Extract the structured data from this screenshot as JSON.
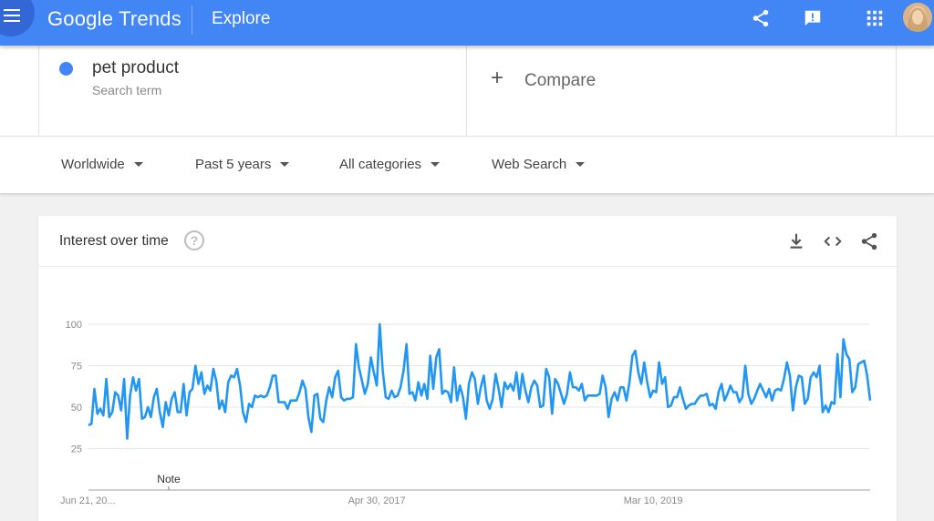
{
  "header": {
    "brand_google": "Google",
    "brand_trends": "Trends",
    "page": "Explore",
    "icons": [
      "menu-icon",
      "share-icon",
      "feedback-icon",
      "apps-icon",
      "avatar"
    ]
  },
  "search": {
    "term": "pet product",
    "term_sub": "Search term",
    "term_color": "#4285f4",
    "compare_label": "Compare"
  },
  "filters": {
    "region": "Worldwide",
    "period": "Past 5 years",
    "category": "All categories",
    "search_type": "Web Search"
  },
  "card": {
    "title": "Interest over time",
    "icons": [
      "help-icon",
      "download-icon",
      "embed-icon",
      "share-icon"
    ]
  },
  "chart_data": {
    "type": "line",
    "series_color": "#2196f3",
    "ylim": [
      0,
      100
    ],
    "y_ticks": [
      25,
      50,
      75,
      100
    ],
    "x_labels": [
      {
        "label": "Jun 21, 20...",
        "index": 0
      },
      {
        "label": "Apr 30, 2017",
        "index": 97
      },
      {
        "label": "Mar 10, 2019",
        "index": 190
      }
    ],
    "note_label": "Note",
    "note_index": 27,
    "series": [
      {
        "values": [
          39,
          40,
          61,
          46,
          49,
          45,
          67,
          44,
          47,
          59,
          57,
          48,
          67,
          31,
          57,
          68,
          60,
          67,
          43,
          44,
          50,
          44,
          56,
          61,
          47,
          38,
          53,
          45,
          55,
          59,
          47,
          47,
          64,
          45,
          59,
          61,
          75,
          64,
          71,
          58,
          63,
          60,
          73,
          66,
          49,
          54,
          47,
          65,
          69,
          68,
          73,
          63,
          47,
          41,
          52,
          50,
          57,
          56,
          57,
          56,
          57,
          62,
          69,
          69,
          53,
          53,
          53,
          49,
          54,
          54,
          54,
          59,
          66,
          61,
          44,
          35,
          57,
          58,
          43,
          41,
          54,
          62,
          56,
          68,
          72,
          56,
          54,
          55,
          55,
          56,
          88,
          74,
          66,
          58,
          64,
          80,
          71,
          63,
          100,
          72,
          56,
          55,
          60,
          56,
          57,
          62,
          72,
          88,
          58,
          59,
          54,
          65,
          57,
          64,
          55,
          81,
          61,
          80,
          85,
          58,
          60,
          59,
          53,
          74,
          54,
          63,
          56,
          43,
          64,
          71,
          67,
          52,
          62,
          69,
          54,
          49,
          55,
          70,
          61,
          50,
          65,
          61,
          64,
          60,
          71,
          55,
          70,
          60,
          53,
          62,
          66,
          63,
          50,
          51,
          73,
          68,
          46,
          67,
          64,
          58,
          52,
          58,
          71,
          62,
          62,
          60,
          64,
          54,
          57,
          57,
          57,
          57,
          58,
          69,
          62,
          44,
          55,
          59,
          54,
          62,
          62,
          54,
          65,
          81,
          84,
          71,
          64,
          77,
          65,
          56,
          60,
          59,
          77,
          64,
          68,
          50,
          51,
          56,
          56,
          62,
          55,
          49,
          51,
          52,
          52,
          55,
          57,
          57,
          58,
          51,
          52,
          49,
          59,
          64,
          54,
          58,
          63,
          59,
          59,
          53,
          56,
          75,
          58,
          52,
          55,
          60,
          64,
          60,
          56,
          61,
          54,
          60,
          61,
          60,
          67,
          77,
          69,
          48,
          62,
          69,
          68,
          52,
          55,
          68,
          71,
          68,
          75,
          47,
          51,
          47,
          53,
          52,
          82,
          56,
          91,
          82,
          79,
          59,
          62,
          76,
          77,
          78,
          69,
          54
        ]
      }
    ]
  }
}
